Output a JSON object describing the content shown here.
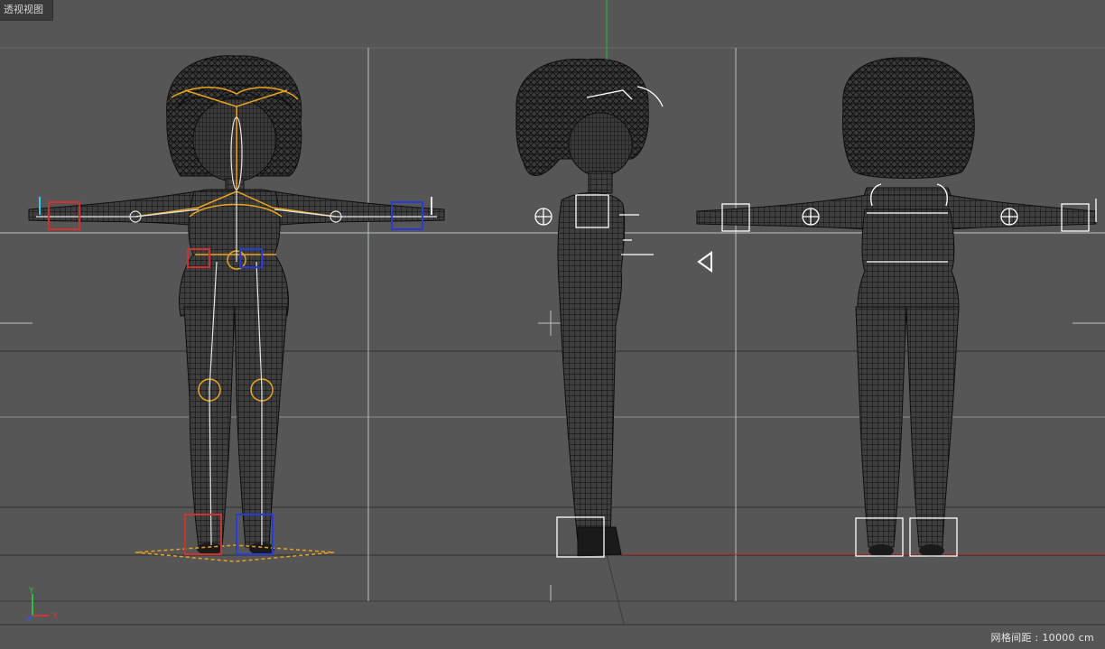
{
  "viewport": {
    "title": "透视视图",
    "grid_spacing": "网格间距 : 10000 cm",
    "axis_labels": {
      "y": "Y",
      "x": "X"
    },
    "colors": {
      "background": "#565656",
      "grid_line": "#777777",
      "guide_line": "#b9c3c0",
      "wire": "#0c0c0c",
      "joint": "#e8a21f",
      "control_red": "#d03030",
      "control_blue": "#2a3ad8",
      "axis_y": "#2fbf3c",
      "axis_x": "#d33535"
    }
  },
  "models": [
    {
      "view": "front",
      "rigged": true
    },
    {
      "view": "side",
      "rigged": false
    },
    {
      "view": "back",
      "rigged": false
    }
  ]
}
